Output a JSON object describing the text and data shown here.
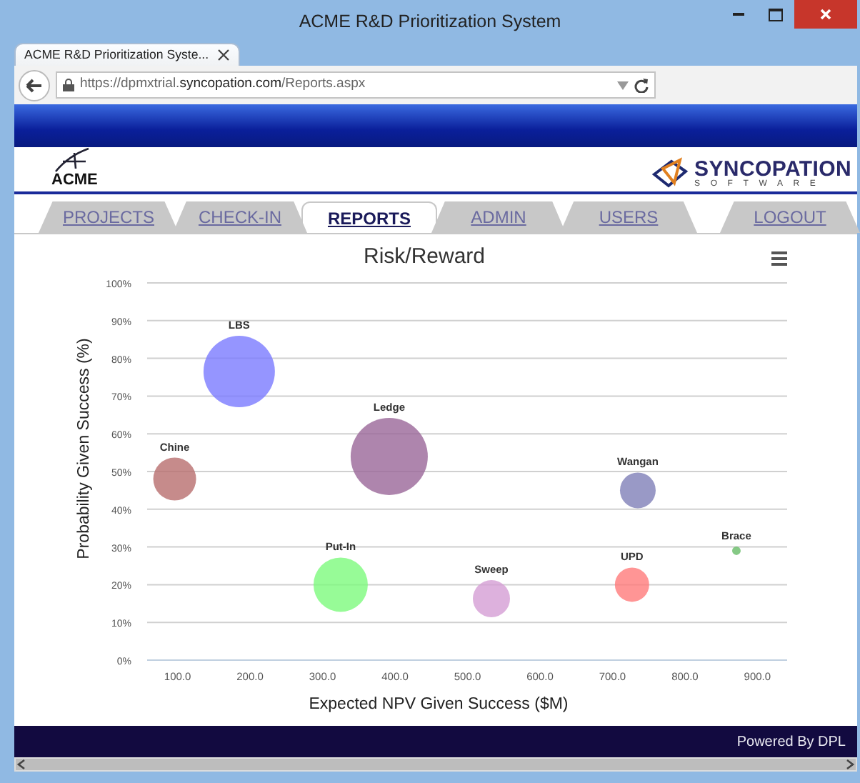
{
  "window": {
    "title": "ACME R&D Prioritization System"
  },
  "browser": {
    "tab": {
      "label": "ACME R&D Prioritization Syste..."
    },
    "address": "https://dpmxtrial.**syncopation.com**/Reports.aspx"
  },
  "header": {
    "logo_text": "ACME",
    "brand": "SYNCOPATION",
    "brand_sub": "SOFTWARE"
  },
  "nav": [
    {
      "label": "PROJECTS",
      "selected": false
    },
    {
      "label": "CHECK-IN",
      "selected": false
    },
    {
      "label": "REPORTS",
      "selected": true
    },
    {
      "label": "ADMIN",
      "selected": false
    },
    {
      "label": "USERS",
      "selected": false
    },
    {
      "label": "LOGOUT",
      "selected": false
    }
  ],
  "report": {
    "chart_data": {
      "type": "scatter",
      "title": "Risk/Reward",
      "xlabel": "Expected NPV Given Success ($M)",
      "ylabel": "Probability Given Success (%)",
      "xlim": [
        58,
        941
      ],
      "ylim": [
        0,
        100
      ],
      "xticks": [
        {
          "value": 100,
          "label": "100.0"
        },
        {
          "value": 200,
          "label": "200.0"
        },
        {
          "value": 300,
          "label": "300.0"
        },
        {
          "value": 400,
          "label": "400.0"
        },
        {
          "value": 500,
          "label": "500.0"
        },
        {
          "value": 600,
          "label": "600.0"
        },
        {
          "value": 700,
          "label": "700.0"
        },
        {
          "value": 800,
          "label": "800.0"
        },
        {
          "value": 900,
          "label": "900.0"
        }
      ],
      "yticks": [
        {
          "value": 0,
          "label": "0%"
        },
        {
          "value": 10,
          "label": "10%"
        },
        {
          "value": 20,
          "label": "20%"
        },
        {
          "value": 30,
          "label": "30%"
        },
        {
          "value": 40,
          "label": "40%"
        },
        {
          "value": 50,
          "label": "50%"
        },
        {
          "value": 60,
          "label": "60%"
        },
        {
          "value": 70,
          "label": "70%"
        },
        {
          "value": 80,
          "label": "80%"
        },
        {
          "value": 90,
          "label": "90%"
        },
        {
          "value": 100,
          "label": "100%"
        }
      ],
      "grid": true,
      "series": [
        {
          "color": "#7b7bff",
          "x": [
            185
          ],
          "values": [
            76.5
          ],
          "value_labels": [
            "LBS"
          ]
        },
        {
          "color": "#b86e6e",
          "x": [
            96
          ],
          "values": [
            48
          ],
          "value_labels": [
            "Chine"
          ]
        },
        {
          "color": "#9a6699",
          "x": [
            392
          ],
          "values": [
            54
          ],
          "value_labels": [
            "Ledge"
          ]
        },
        {
          "color": "#7dfa7d",
          "x": [
            325
          ],
          "values": [
            20
          ],
          "value_labels": [
            "Put-In"
          ]
        },
        {
          "color": "#d49ed4",
          "x": [
            533
          ],
          "values": [
            16.3
          ],
          "value_labels": [
            "Sweep"
          ]
        },
        {
          "color": "#ff7b7b",
          "x": [
            727
          ],
          "values": [
            20
          ],
          "value_labels": [
            "UPD"
          ]
        },
        {
          "color": "#7f7fb8",
          "x": [
            735
          ],
          "values": [
            45
          ],
          "value_labels": [
            "Wangan"
          ]
        },
        {
          "color": "#66bb66",
          "x": [
            871
          ],
          "values": [
            29
          ],
          "value_labels": [
            "Brace"
          ]
        }
      ]
    }
  },
  "footer": {
    "text": "Powered By DPL"
  }
}
